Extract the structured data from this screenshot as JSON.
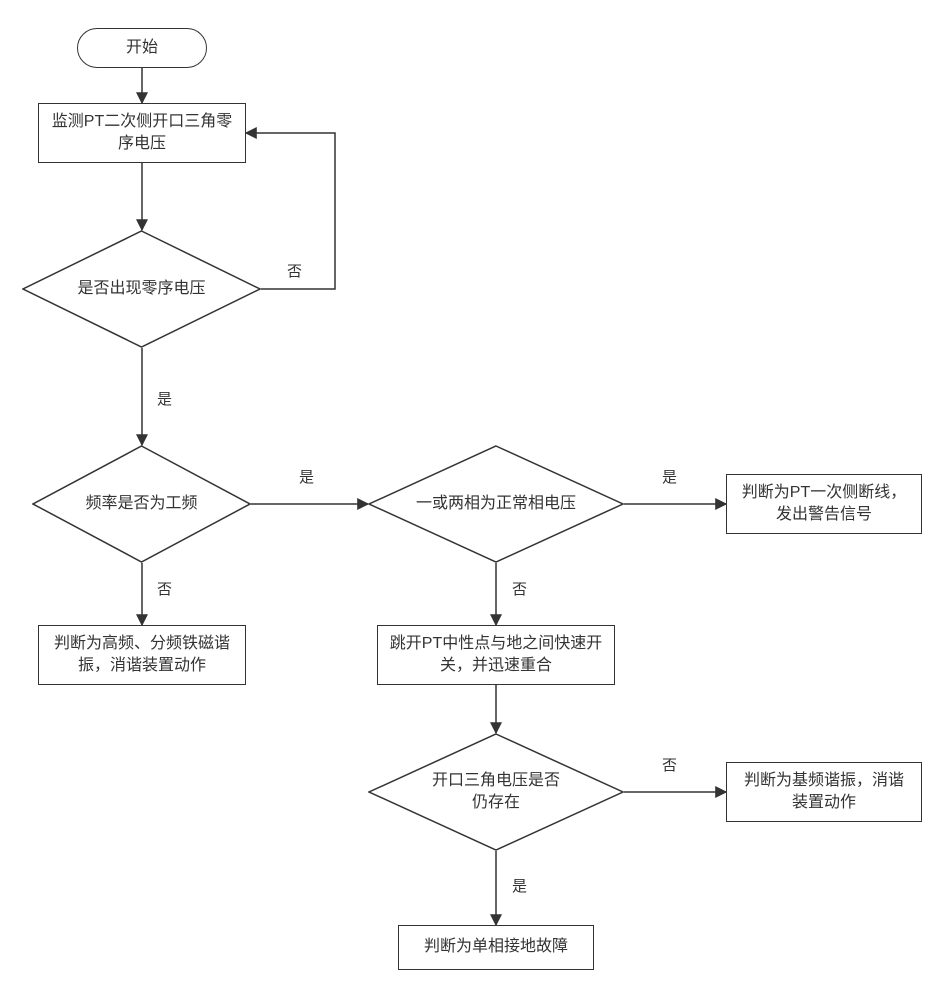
{
  "chart_data": {
    "type": "flowchart",
    "title": "",
    "nodes": [
      {
        "id": "start",
        "kind": "terminator",
        "label": "开始"
      },
      {
        "id": "monitor",
        "kind": "process",
        "label": "监测PT二次侧开口三角零序电压"
      },
      {
        "id": "zero_seq",
        "kind": "decision",
        "label": "是否出现零序电压"
      },
      {
        "id": "freq",
        "kind": "decision",
        "label": "频率是否为工频"
      },
      {
        "id": "hf_resonance",
        "kind": "process",
        "label": "判断为高频、分频铁磁谐振，消谐装置动作"
      },
      {
        "id": "phase_normal",
        "kind": "decision",
        "label": "一或两相为正常相电压"
      },
      {
        "id": "pt_open",
        "kind": "process",
        "label": "判断为PT一次侧断线，发出警告信号"
      },
      {
        "id": "trip_reclose",
        "kind": "process",
        "label": "跳开PT中性点与地之间快速开关，并迅速重合"
      },
      {
        "id": "still_exists",
        "kind": "decision",
        "label": "开口三角电压是否仍存在"
      },
      {
        "id": "fund_resonance",
        "kind": "process",
        "label": "判断为基频谐振，消谐装置动作"
      },
      {
        "id": "ground_fault",
        "kind": "process",
        "label": "判断为单相接地故障"
      }
    ],
    "edges": [
      {
        "from": "start",
        "to": "monitor",
        "label": ""
      },
      {
        "from": "monitor",
        "to": "zero_seq",
        "label": ""
      },
      {
        "from": "zero_seq",
        "to": "monitor",
        "label": "否"
      },
      {
        "from": "zero_seq",
        "to": "freq",
        "label": "是"
      },
      {
        "from": "freq",
        "to": "hf_resonance",
        "label": "否"
      },
      {
        "from": "freq",
        "to": "phase_normal",
        "label": "是"
      },
      {
        "from": "phase_normal",
        "to": "pt_open",
        "label": "是"
      },
      {
        "from": "phase_normal",
        "to": "trip_reclose",
        "label": "否"
      },
      {
        "from": "trip_reclose",
        "to": "still_exists",
        "label": ""
      },
      {
        "from": "still_exists",
        "to": "fund_resonance",
        "label": "否"
      },
      {
        "from": "still_exists",
        "to": "ground_fault",
        "label": "是"
      }
    ]
  },
  "labels": {
    "yes": "是",
    "no": "否"
  }
}
